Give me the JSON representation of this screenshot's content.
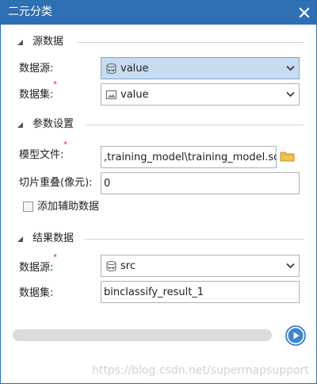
{
  "window": {
    "title": "二元分类",
    "close_icon": "close-icon",
    "accent_color": "#2f6fb3"
  },
  "source_section": {
    "title": "源数据",
    "datasource": {
      "label": "数据源:",
      "value": "value",
      "icon": "database-icon",
      "required": "*"
    },
    "dataset": {
      "label": "数据集:",
      "value": "value",
      "icon": "image-dataset-icon",
      "required": "*"
    }
  },
  "params_section": {
    "title": "参数设置",
    "model_file": {
      "label": "模型文件:",
      "value": ",training_model\\training_model.sdm",
      "required": "*",
      "icon": "folder-icon"
    },
    "tile_overlap": {
      "label": "切片重叠(像元):",
      "value": "0"
    },
    "aux_data": {
      "label": "添加辅助数据",
      "checked": false
    }
  },
  "result_section": {
    "title": "结果数据",
    "datasource": {
      "label": "数据源:",
      "value": "src",
      "icon": "database-icon",
      "required": "*"
    },
    "dataset": {
      "label": "数据集:",
      "value": "binclassify_result_1"
    }
  },
  "progress": {
    "value": 0
  },
  "run_button": {
    "icon": "run-icon"
  },
  "watermark": "https://blog.csdn.net/supermapsupport"
}
